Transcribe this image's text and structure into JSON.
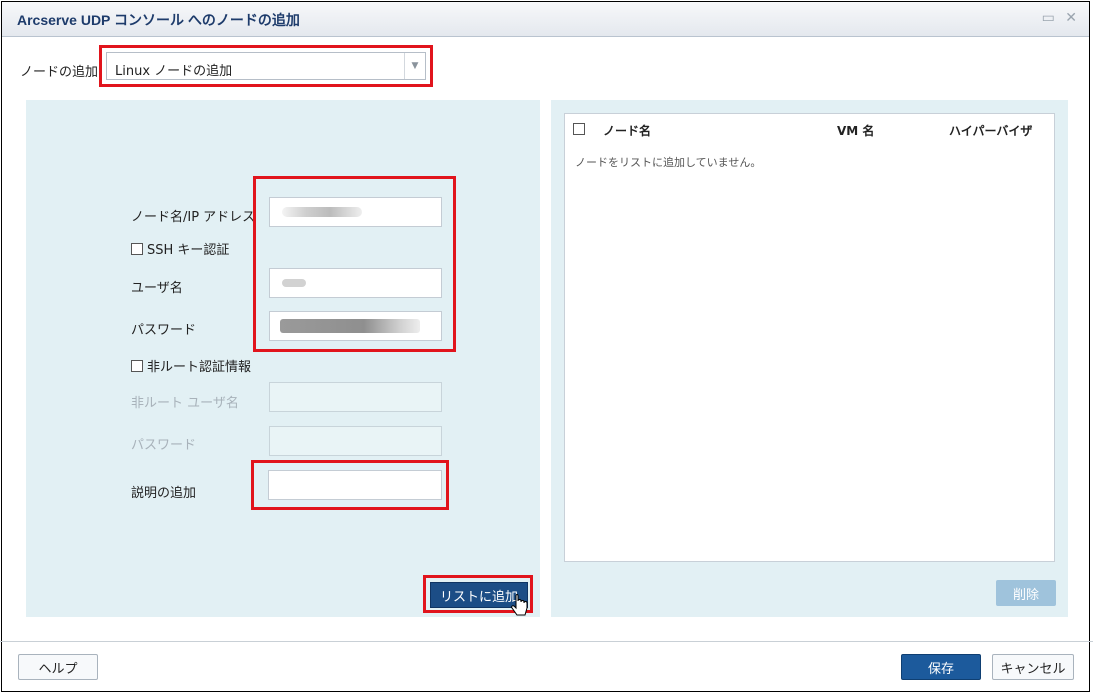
{
  "dialog": {
    "title": "Arcserve UDP コンソール へのノードの追加",
    "icons": [
      "restore-icon",
      "close-icon"
    ]
  },
  "node_type": {
    "label": "ノードの追加",
    "selected": "Linux ノードの追加"
  },
  "form": {
    "node_name_label": "ノード名/IP アドレス",
    "ssh_key_label": "SSH キー認証",
    "user_label": "ユーザ名",
    "password_label": "パスワード",
    "non_root_label": "非ルート認証情報",
    "non_root_user_label": "非ルート ユーザ名",
    "non_root_password_label": "パスワード",
    "description_label": "説明の追加",
    "add_to_list_button": "リストに追加"
  },
  "node_list": {
    "columns": [
      "ノード名",
      "VM 名",
      "ハイパーバイザ"
    ],
    "empty_message": "ノードをリストに追加していません。",
    "delete_button": "削除"
  },
  "footer": {
    "help_button": "ヘルプ",
    "save_button": "保存",
    "cancel_button": "キャンセル"
  },
  "colors": {
    "highlight": "#e1141c",
    "primary_button": "#1c5a9c",
    "panel_bg": "#e2f0f4"
  }
}
